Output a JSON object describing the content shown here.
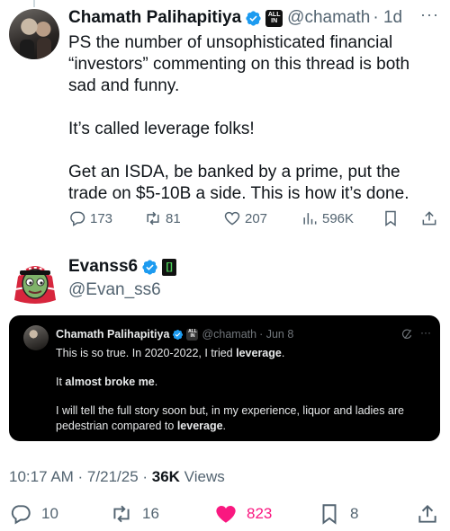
{
  "reply_tweet": {
    "author": {
      "name": "Chamath Palihapitiya",
      "handle": "@chamath",
      "time": "· 1d",
      "affiliate_badge": [
        "ALL",
        "IN"
      ]
    },
    "more_label": "···",
    "paragraphs": [
      "PS the number of unsophisticated financial “investors” commenting on this thread is both sad and funny.",
      "It’s called leverage folks!",
      "Get an ISDA, be banked by a prime, put the trade on $5-10B a side. This is how it’s done."
    ],
    "actions": {
      "replies": "173",
      "reposts": "81",
      "likes": "207",
      "views": "596K"
    }
  },
  "main_tweet": {
    "author": {
      "name": "Evanss6",
      "handle": "@Evan_ss6",
      "badge_glyph": "[]"
    },
    "quoted": {
      "author": {
        "name": "Chamath Palihapitiya",
        "handle": "@chamath",
        "time": "· Jun 8",
        "affiliate_badge": [
          "ALL",
          "IN"
        ]
      },
      "more_label": "···",
      "p1_before": "This is so true. In 2020-2022, I tried ",
      "p1_bold": "leverage",
      "p1_after": ".",
      "p2_before": "It ",
      "p2_bold": "almost broke me",
      "p2_after": ".",
      "p3_before": "I will tell the full story soon but, in my experience, liquor and ladies are pedestrian compared to ",
      "p3_bold": "leverage",
      "p3_after": "."
    },
    "meta": {
      "timestamp": "10:17 AM · 7/21/25 · ",
      "views_count": "36K",
      "views_label": " Views"
    },
    "actions": {
      "replies": "10",
      "reposts": "16",
      "likes": "823",
      "bookmarks": "8"
    },
    "colors": {
      "like_active": "#f91880",
      "verified": "#1d9bf0"
    }
  }
}
